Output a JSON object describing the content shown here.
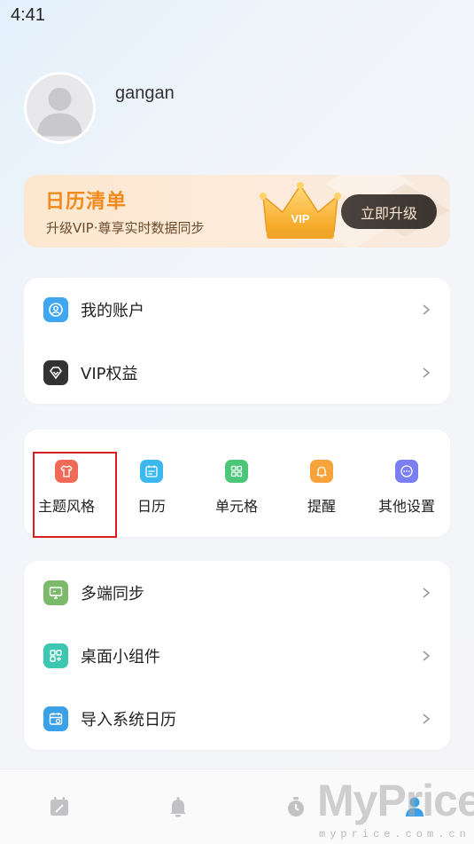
{
  "status_bar": {
    "time": "4:41"
  },
  "profile": {
    "username": "gangan"
  },
  "vip_banner": {
    "title": "日历清单",
    "subtitle": "升级VIP·尊享实时数据同步",
    "crown_text": "VIP",
    "button_label": "立即升级"
  },
  "account_menu": [
    {
      "label": "我的账户",
      "icon": "account-icon",
      "color": "#3ea6f2"
    },
    {
      "label": "VIP权益",
      "icon": "diamond-icon",
      "color": "#333333"
    }
  ],
  "settings_grid": [
    {
      "label": "主题风格",
      "icon": "shirt-icon",
      "color": "#ef6b58"
    },
    {
      "label": "日历",
      "icon": "calendar-icon",
      "color": "#3cb8ee"
    },
    {
      "label": "单元格",
      "icon": "grid-icon",
      "color": "#4cc77a"
    },
    {
      "label": "提醒",
      "icon": "bell-icon",
      "color": "#f5a33a"
    },
    {
      "label": "其他设置",
      "icon": "more-icon",
      "color": "#7a7ef0"
    }
  ],
  "feature_menu": [
    {
      "label": "多端同步",
      "icon": "sync-device-icon",
      "color": "#7cb96a"
    },
    {
      "label": "桌面小组件",
      "icon": "widget-icon",
      "color": "#3cc7b0"
    },
    {
      "label": "导入系统日历",
      "icon": "import-calendar-icon",
      "color": "#3aa0e8"
    }
  ],
  "tabbar": [
    {
      "name": "calendar-tab",
      "icon": "calendar-icon"
    },
    {
      "name": "reminder-tab",
      "icon": "bell-icon"
    },
    {
      "name": "timer-tab",
      "icon": "stopwatch-icon"
    },
    {
      "name": "profile-tab",
      "icon": "person-icon",
      "active": true
    }
  ],
  "watermark": {
    "text": "MyPrice",
    "url": "myprice.com.cn"
  },
  "accent_colors": {
    "vip_orange": "#f08a1c",
    "active_tab": "#3aa0e8",
    "highlight_box": "#d81e1e"
  }
}
